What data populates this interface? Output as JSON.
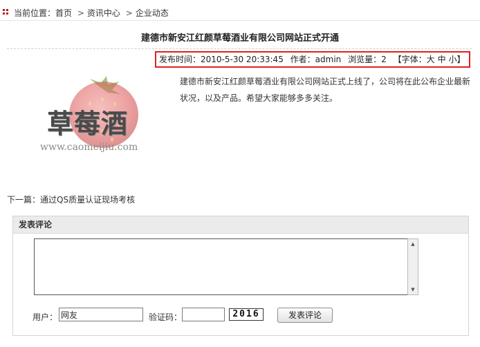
{
  "breadcrumb": {
    "prefix": "当前位置：",
    "items": [
      "首页",
      "资讯中心",
      "企业动态"
    ],
    "separator": ">"
  },
  "article": {
    "title": "建德市新安江红颜草莓酒业有限公司网站正式开通",
    "meta": {
      "date_label": "发布时间：",
      "date": "2010-5-30 20:33:45",
      "author_label": "作者：",
      "author": "admin",
      "views_label": "浏览量：",
      "views": "2",
      "font_label": "【字体：",
      "font_large": "大",
      "font_medium": "中",
      "font_small": "小",
      "font_close": "】"
    },
    "logo_text": "草莓酒",
    "logo_url": "www.caomeijiu.com",
    "content": "建德市新安江红颜草莓酒业有限公司网站正式上线了，公司将在此公布企业最新状况，以及产品。希望大家能够多多关注。"
  },
  "next_article": {
    "label": "下一篇：",
    "title": "通过QS质量认证现场考核"
  },
  "comment": {
    "header": "发表评论",
    "textarea_value": "",
    "user_label": "用户：",
    "user_value": "网友",
    "captcha_label": "验证码：",
    "captcha_value": "",
    "captcha_text": "2016",
    "submit_label": "发表评论"
  },
  "colors": {
    "accent_red": "#c4161c",
    "meta_border": "#e02020",
    "panel_header_bg": "#ebebeb"
  },
  "icons": {
    "breadcrumb": "grid-bullet-icon",
    "scroll_up": "triangle-up-icon",
    "scroll_down": "triangle-down-icon"
  }
}
